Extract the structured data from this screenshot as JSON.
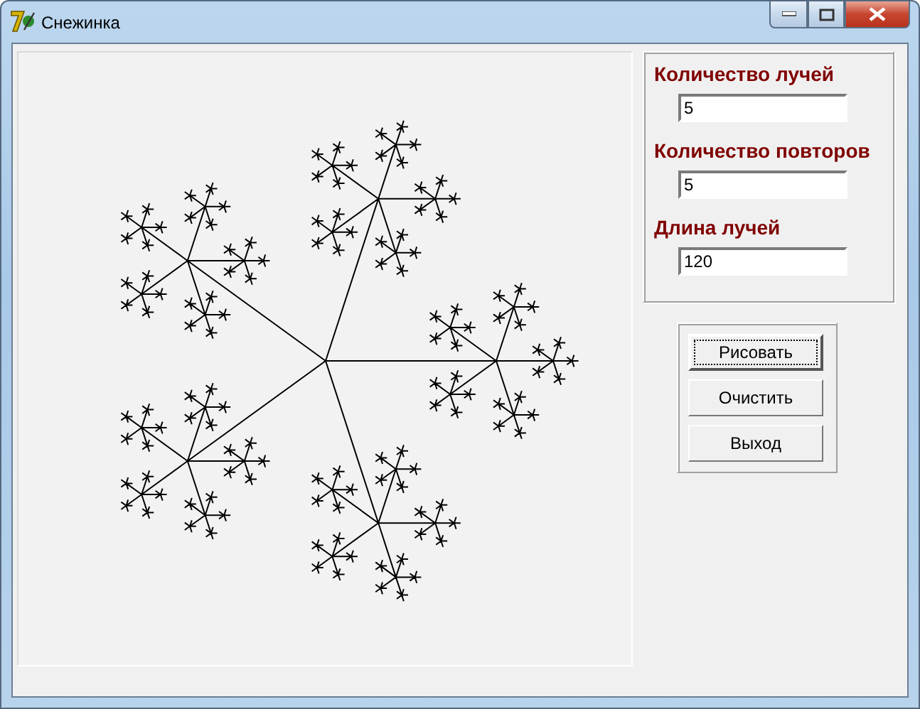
{
  "window": {
    "title": "Снежинка"
  },
  "snowflake": {
    "kind": "picture-fractal"
  },
  "fields": [
    {
      "label": "Количество лучей",
      "value": "5"
    },
    {
      "label": "Количество повторов",
      "value": "5"
    },
    {
      "label": "Длина лучей",
      "value": "120"
    }
  ],
  "buttons": [
    {
      "label": "Рисовать",
      "focused": true
    },
    {
      "label": "Очистить",
      "focused": false
    },
    {
      "label": "Выход",
      "focused": false
    }
  ]
}
